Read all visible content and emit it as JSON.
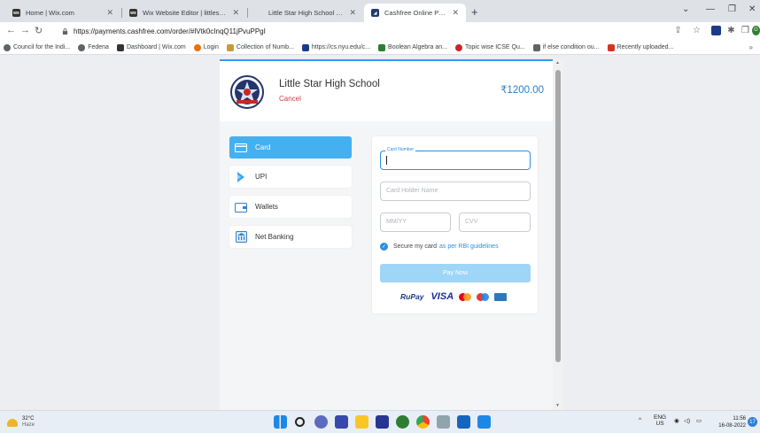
{
  "browser": {
    "tabs": [
      {
        "title": "Home | Wix.com",
        "favicon": "wix",
        "active": false
      },
      {
        "title": "Wix Website Editor | littlestarhi(",
        "favicon": "wix",
        "active": false
      },
      {
        "title": "Little Star High School Bally | ICS",
        "favicon": "blank",
        "active": false
      },
      {
        "title": "Cashfree Online Payments",
        "favicon": "cashfree",
        "active": true
      }
    ],
    "url": "https://payments.cashfree.com/order/#lVtk0cInqQ11jPvuPPgI",
    "bookmarks": [
      {
        "label": "Council for the Indi...",
        "color": "#5f6368"
      },
      {
        "label": "Fedena",
        "color": "#5f6368"
      },
      {
        "label": "Dashboard | Wix.com",
        "color": "#333333"
      },
      {
        "label": "Login",
        "color": "#e8710a"
      },
      {
        "label": "Collection of Numb...",
        "color": "#c39b3a"
      },
      {
        "label": "https://cs.nyu.edu/c...",
        "color": "#1a3a8a"
      },
      {
        "label": "Boolean Algebra an...",
        "color": "#2e7d32"
      },
      {
        "label": "Topic wise ICSE Qu...",
        "color": "#c62828"
      },
      {
        "label": "if else condition ou...",
        "color": "#5f6368"
      },
      {
        "label": "Recently uploaded...",
        "color": "#d93025"
      }
    ],
    "profile_initial": "G"
  },
  "checkout": {
    "merchant": "Little Star High School",
    "cancel_label": "Cancel",
    "amount": "₹1200.00",
    "methods": [
      {
        "label": "Card",
        "icon": "card-icon",
        "active": true
      },
      {
        "label": "UPI",
        "icon": "upi-icon",
        "active": false
      },
      {
        "label": "Wallets",
        "icon": "wallet-icon",
        "active": false
      },
      {
        "label": "Net Banking",
        "icon": "bank-icon",
        "active": false
      }
    ],
    "form": {
      "card_number_label": "Card Number",
      "card_number_value": "",
      "holder_placeholder": "Card Holder Name",
      "expiry_placeholder": "MM/YY",
      "cvv_placeholder": "CVV",
      "secure_text": "Secure my card",
      "secure_link": "as per RBI guidelines",
      "secure_checked": true,
      "pay_label": "Pay Now"
    },
    "brands": [
      "RuPay",
      "VISA",
      "mastercard-icon",
      "maestro-icon",
      "amex-icon"
    ]
  },
  "taskbar": {
    "temperature": "32°C",
    "weather": "Haze",
    "lang": "ENG",
    "region": "US",
    "time": "11:56",
    "date": "16-08-2022",
    "notifications": "17"
  }
}
